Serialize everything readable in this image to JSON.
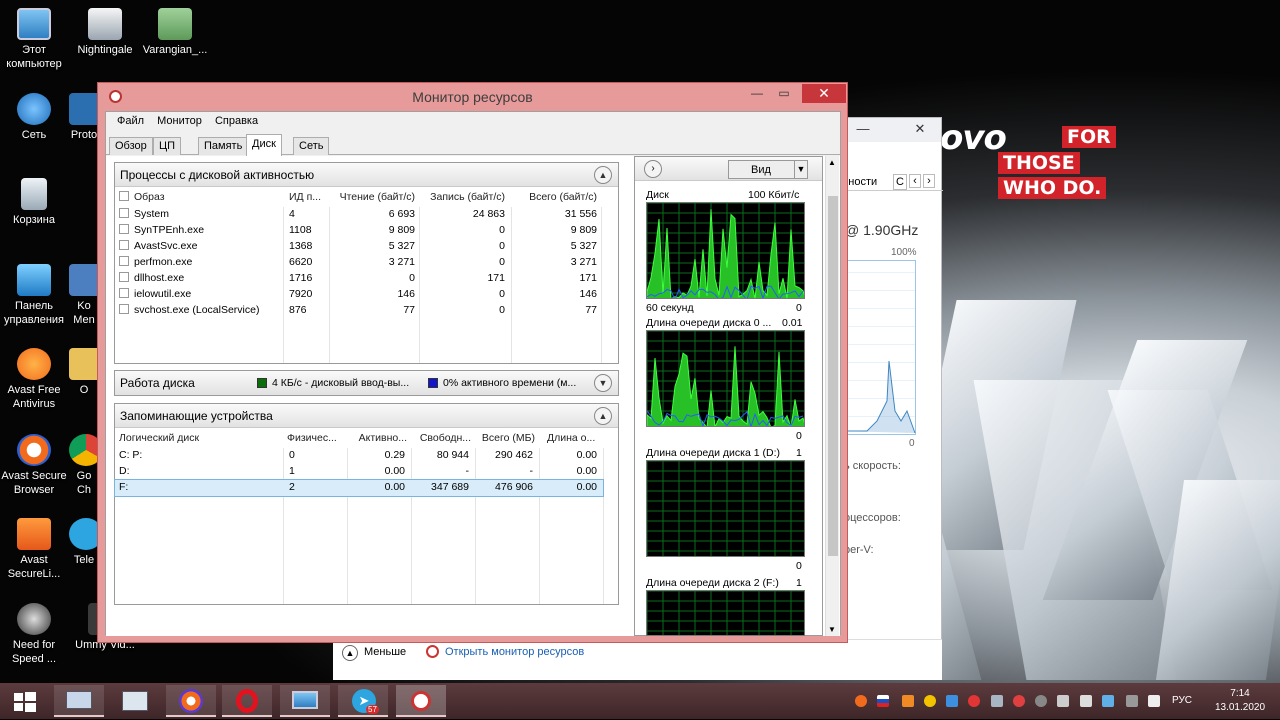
{
  "desktop": {
    "icons": [
      {
        "label": "Этот компьютер"
      },
      {
        "label": "Nightingale"
      },
      {
        "label": "Varangian_..."
      },
      {
        "label": "Сеть"
      },
      {
        "label": "Proto"
      },
      {
        "label": "Корзина"
      },
      {
        "label": "Панель управления"
      },
      {
        "label": "Ko Men"
      },
      {
        "label": "Avast Free Antivirus"
      },
      {
        "label": "O"
      },
      {
        "label": "Avast Secure Browser"
      },
      {
        "label": "Go Ch"
      },
      {
        "label": "Avast SecureLi..."
      },
      {
        "label": "Tele"
      },
      {
        "label": "Need for Speed ..."
      },
      {
        "label": "Ummy Vid..."
      }
    ],
    "brand": {
      "logo": "ovo",
      "line1": "FOR",
      "line2": "THOSE",
      "line3": "WHO DO."
    }
  },
  "background_window": {
    "tab_partial": "бности",
    "tab_next": "С",
    "cpu_speed": "@ 1.90GHz",
    "percent": "100%",
    "zero": "0",
    "speed_label": "ь скорость:",
    "processors_label": "оцессоров:",
    "hyperv_label": "per-V:",
    "bottom": {
      "less": "Меньше",
      "open_monitor": "Открыть монитор ресурсов"
    }
  },
  "window": {
    "title": "Монитор ресурсов",
    "menu": [
      "Файл",
      "Монитор",
      "Справка"
    ],
    "tabs": [
      "Обзор",
      "ЦП",
      "Память",
      "Диск",
      "Сеть"
    ],
    "active_tab": "Диск"
  },
  "processes": {
    "title": "Процессы с дисковой активностью",
    "columns": [
      "Образ",
      "ИД п...",
      "Чтение (байт/с)",
      "Запись (байт/с)",
      "Всего (байт/с)"
    ],
    "rows": [
      {
        "image": "System",
        "pid": "4",
        "read": "6 693",
        "write": "24 863",
        "total": "31 556"
      },
      {
        "image": "SynTPEnh.exe",
        "pid": "1108",
        "read": "9 809",
        "write": "0",
        "total": "9 809"
      },
      {
        "image": "AvastSvc.exe",
        "pid": "1368",
        "read": "5 327",
        "write": "0",
        "total": "5 327"
      },
      {
        "image": "perfmon.exe",
        "pid": "6620",
        "read": "3 271",
        "write": "0",
        "total": "3 271"
      },
      {
        "image": "dllhost.exe",
        "pid": "1716",
        "read": "0",
        "write": "171",
        "total": "171"
      },
      {
        "image": "ielowutil.exe",
        "pid": "7920",
        "read": "146",
        "write": "0",
        "total": "146"
      },
      {
        "image": "svchost.exe (LocalService)",
        "pid": "876",
        "read": "77",
        "write": "0",
        "total": "77"
      }
    ]
  },
  "disk_activity": {
    "title": "Работа диска",
    "io_legend": "4 КБ/с - дисковый ввод-вы...",
    "active_legend": "0% активного времени (м...",
    "io_color": "#0a6e0a",
    "active_color": "#1414c8"
  },
  "storage": {
    "title": "Запоминающие устройства",
    "columns": [
      "Логический диск",
      "Физичес...",
      "Активно...",
      "Свободн...",
      "Всего (МБ)",
      "Длина о..."
    ],
    "rows": [
      {
        "disk": "C: P:",
        "physical": "0",
        "active": "0.29",
        "free": "80 944",
        "total": "290 462",
        "queue": "0.00"
      },
      {
        "disk": "D:",
        "physical": "1",
        "active": "0.00",
        "free": "-",
        "total": "-",
        "queue": "0.00"
      },
      {
        "disk": "F:",
        "physical": "2",
        "active": "0.00",
        "free": "347 689",
        "total": "476 906",
        "queue": "0.00"
      }
    ]
  },
  "graphs": {
    "view_label": "Вид",
    "disk": {
      "label": "Диск",
      "scale": "100 Кбит/с",
      "time": "60 секунд",
      "min": "0"
    },
    "queue0": {
      "label": "Длина очереди диска 0 ...",
      "scale": "0.01",
      "min": "0"
    },
    "queue1": {
      "label": "Длина очереди диска 1 (D:)",
      "scale": "1",
      "min": "0"
    },
    "queue2": {
      "label": "Длина очереди диска 2 (F:)",
      "scale": "1"
    }
  },
  "taskbar": {
    "language": "РУС",
    "time": "7:14",
    "date": "13.01.2020",
    "telegram_badge": "57"
  }
}
